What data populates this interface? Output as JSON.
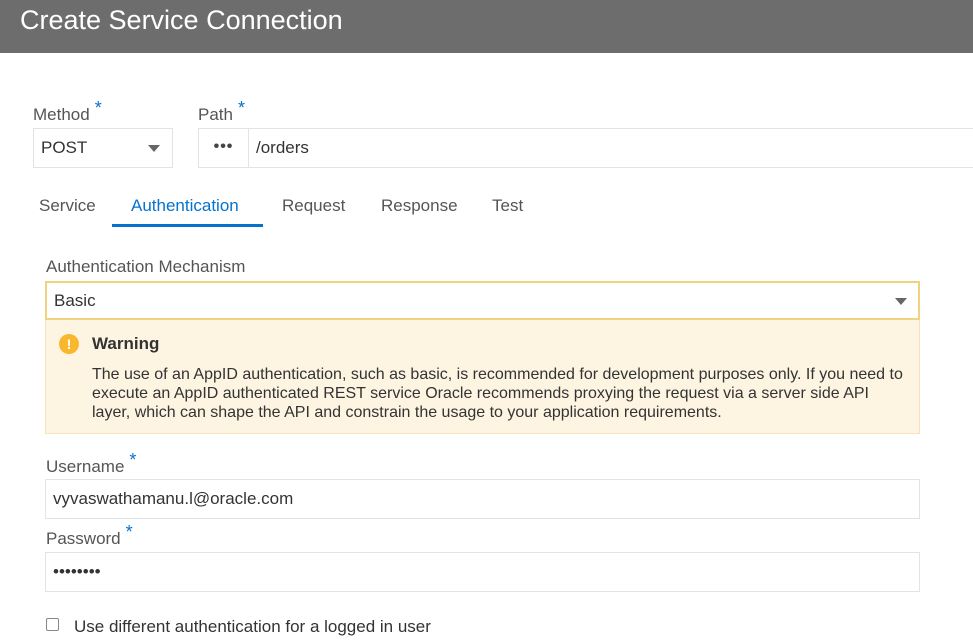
{
  "dialog": {
    "title": "Create Service Connection"
  },
  "method": {
    "label": "Method",
    "required": "*",
    "value": "POST"
  },
  "path": {
    "label": "Path",
    "required": "*",
    "dots": "•••",
    "value": "/orders"
  },
  "tabs": [
    {
      "label": "Service",
      "active": false
    },
    {
      "label": "Authentication",
      "active": true
    },
    {
      "label": "Request",
      "active": false
    },
    {
      "label": "Response",
      "active": false
    },
    {
      "label": "Test",
      "active": false
    }
  ],
  "auth": {
    "label": "Authentication Mechanism",
    "value": "Basic"
  },
  "warning": {
    "icon": "!",
    "title": "Warning",
    "text": "The use of an AppID authentication, such as basic, is recommended for development purposes only. If you need to execute an AppID authenticated REST service Oracle recommends proxying the request via a server side API layer, which can shape the API and constrain the usage to your application requirements."
  },
  "username": {
    "label": "Username",
    "required": "*",
    "value": "vyvaswathamanu.l@oracle.com"
  },
  "password": {
    "label": "Password",
    "required": "*",
    "value": "••••••••"
  },
  "alt_auth": {
    "label": "Use different authentication for a logged in user",
    "checked": false
  },
  "colors": {
    "accent": "#0572ce",
    "titlebar": "#6d6d6d",
    "warning_bg": "#fdf4e2",
    "warning_icon": "#f8b72d",
    "focus_border": "#f0d380"
  }
}
